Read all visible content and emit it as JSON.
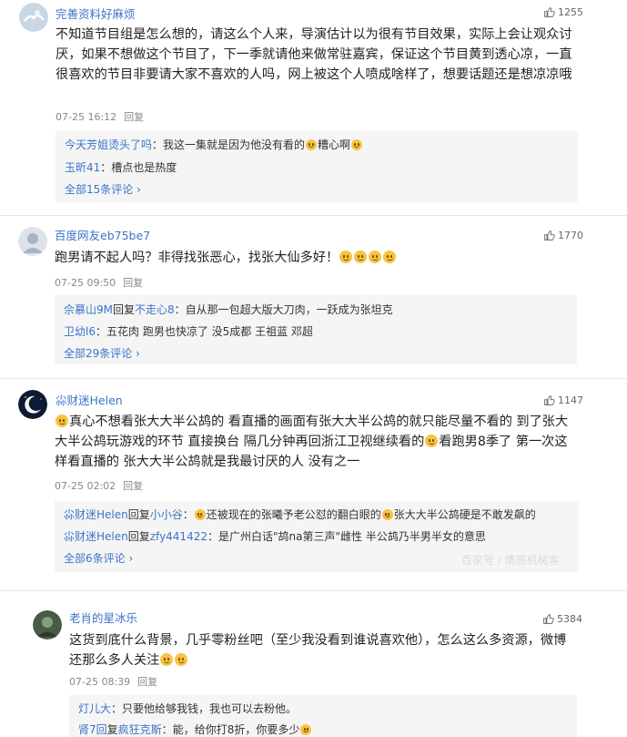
{
  "colors": {
    "link": "#3b73c9",
    "reply_bg": "#f5f5f5",
    "emoji": "#f6c343"
  },
  "comments": [
    {
      "username": "完善资料好麻烦",
      "likes": "1255",
      "text": "不知道节目组是怎么想的，请这么个人来，导演估计以为很有节目效果，实际上会让观众讨厌，如果不想做这个节目了，下一季就请他来做常驻嘉宾，保证这个节目黄到透心凉，一直很喜欢的节目非要请大家不喜欢的人吗，网上被这个人喷成啥样了，想要话题还是想凉凉哦",
      "time": "07-25 16:12",
      "reply_label": "回复",
      "replies": [
        {
          "name": "今天芳姐烫头了吗",
          "sep": "：",
          "text": "我这一集就是因为他没有看的",
          "text2": "糟心啊",
          "emoji": [
            "sad-face-icon",
            "sad-face-icon"
          ]
        },
        {
          "name": "玉昕41",
          "sep": "：",
          "text": "槽点也是热度"
        }
      ],
      "all_replies": "全部15条评论 ›"
    },
    {
      "username": "百度网友eb75be7",
      "likes": "1770",
      "text": "跑男请不起人吗？非得找张恶心，找张大仙多好！",
      "emoji_after": [
        "grin-icon",
        "grin-icon",
        "grin-icon",
        "grin-icon"
      ],
      "time": "07-25 09:50",
      "reply_label": "回复",
      "replies": [
        {
          "name": "佘慕山9M",
          "reply_word": "回复",
          "target": "不走心8",
          "sep": "：",
          "text": "自从那一包超大版大刀肉，一跃成为张坦克"
        },
        {
          "name": "卫幼l6",
          "sep": "：",
          "text": "五花肉 跑男也快凉了 没5成都 王祖蓝 邓超"
        }
      ],
      "all_replies": "全部29条评论 ›"
    },
    {
      "username": "尛财迷Helen",
      "likes": "1147",
      "text_part1": "真心不想看张大大半公鸪的 看直播的画面有张大大半公鸪的就只能尽量不看的 到了张大大半公鸪玩游戏的环节 直接换台 隔几分钟再回浙江卫视继续看的",
      "text_part2": "看跑男8季了 第一次这样看直播的 张大大半公鸪就是我最讨厌的人 没有之一",
      "time": "07-25 02:02",
      "reply_label": "回复",
      "replies": [
        {
          "name": "尛财迷Helen",
          "reply_word": "回复",
          "target": "小小谷",
          "sep": "：",
          "text": "还被现在的张曦予老公怼的翻白眼的",
          "text2": "张大大半公鸪硬是不敢发飙的"
        },
        {
          "name": "尛财迷Helen",
          "reply_word": "回复",
          "target": "zfy441422",
          "sep": "：",
          "text": "是广州白话\"鸪na第三声\"雌性 半公鸪乃半男半女的意思"
        }
      ],
      "all_replies": "全部6条评论 ›"
    },
    {
      "username": "老肖的星冰乐",
      "likes": "5384",
      "text": "这货到底什么背景，几乎零粉丝吧（至少我没看到谁说喜欢他），怎么这么多资源，微博还那么多人关注",
      "time": "07-25 08:39",
      "reply_label": "回复",
      "replies": [
        {
          "name": "灯儿大",
          "sep": "：",
          "text": "只要他给够我钱，我也可以去粉他。"
        },
        {
          "name": "肾7回",
          "reply_word": "复",
          "target": "疯狂克斯",
          "sep": "：",
          "text": "能，给你打8折，你要多少"
        }
      ]
    }
  ],
  "watermark": "百家号 / 情感机械客"
}
